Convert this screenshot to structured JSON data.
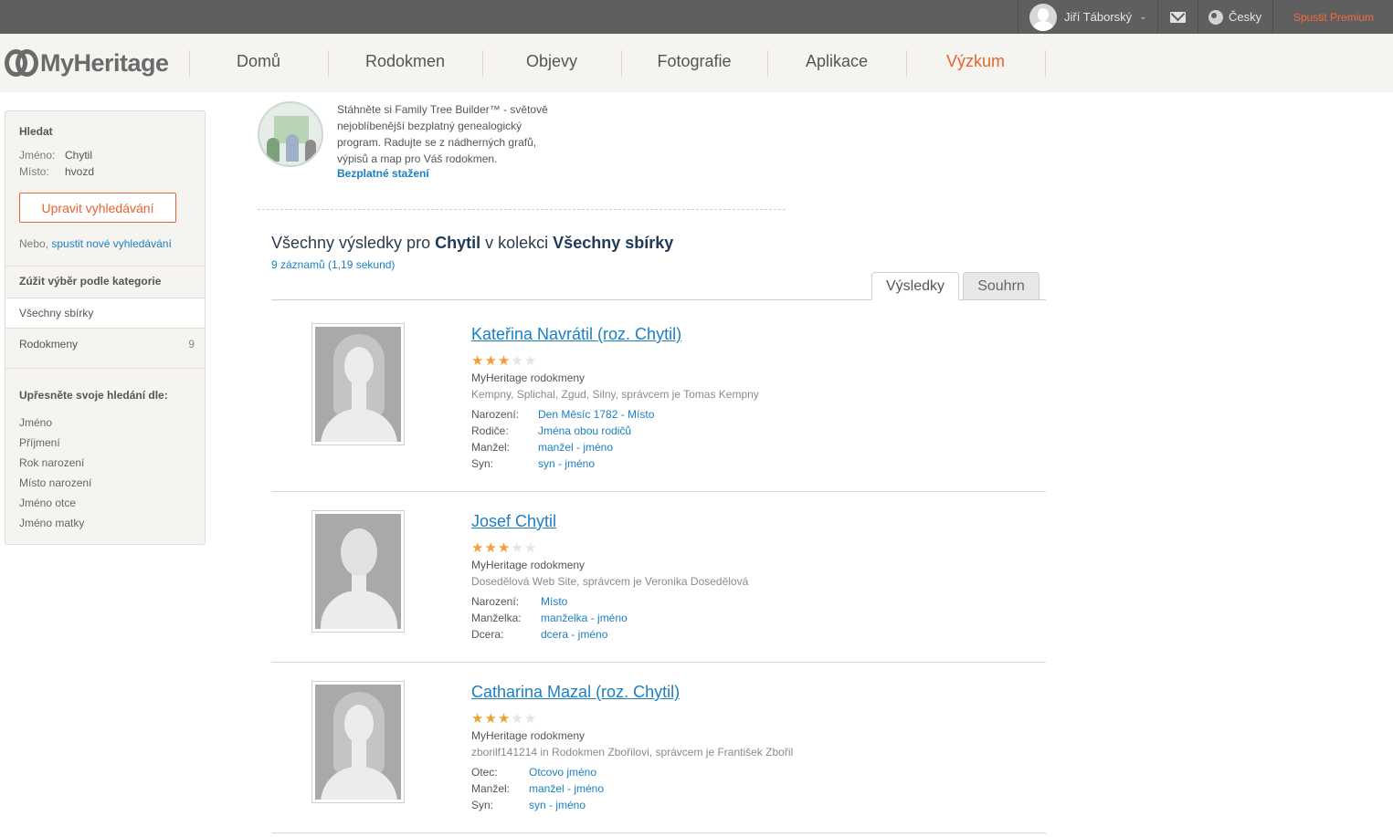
{
  "topbar": {
    "user_name": "Jiří Táborský",
    "language": "Česky",
    "premium_label": "Spustit Premium"
  },
  "logo": {
    "text": "MyHeritage"
  },
  "nav": {
    "items": [
      "Domů",
      "Rodokmen",
      "Objevy",
      "Fotografie",
      "Aplikace",
      "Výzkum"
    ],
    "active": "Výzkum"
  },
  "sidebar": {
    "search_title": "Hledat",
    "name_label": "Jméno:",
    "name_value": "Chytil",
    "place_label": "Místo:",
    "place_value": "hvozd",
    "edit_button": "Upravit vyhledávání",
    "or_text": "Nebo,",
    "new_search_link": "spustit nové vyhledávání",
    "category_title": "Zúžit výběr podle kategorie",
    "category_all": "Všechny sbírky",
    "category_row_label": "Rodokmeny",
    "category_row_count": "9",
    "refine_title": "Upřesněte svoje hledání dle:",
    "refine_items": [
      "Jméno",
      "Příjmení",
      "Rok narození",
      "Místo narození",
      "Jméno otce",
      "Jméno matky"
    ]
  },
  "promo": {
    "text": "Stáhněte si Family Tree Builder™ - světově nejoblíbenější bezplatný genealogický program. Radujte se z nádherných grafů, výpisů a map pro Váš rodokmen.",
    "link": "Bezplatné stažení"
  },
  "results": {
    "title_prefix": "Všechny výsledky pro",
    "query": "Chytil",
    "title_mid": "v kolekci",
    "collection": "Všechny sbírky",
    "count_text": "9 záznamů (1,19 sekund)",
    "tabs": [
      "Výsledky",
      "Souhrn"
    ],
    "items": [
      {
        "name": "Kateřina Navrátil (roz. Chytil)",
        "rating": 3,
        "source": "MyHeritage rodokmeny",
        "subtitle": "Kempny, Splichal, Zgud, Silny, správcem je Tomas Kempny",
        "fields": [
          {
            "label": "Narození:",
            "value": "Den Měsíc 1782 - Místo"
          },
          {
            "label": "Rodiče:",
            "value": "Jména obou rodičů"
          },
          {
            "label": "Manžel:",
            "value": "manžel - jméno"
          },
          {
            "label": "Syn:",
            "value": "syn - jméno"
          }
        ]
      },
      {
        "name": "Josef Chytil",
        "rating": 3,
        "source": "MyHeritage rodokmeny",
        "subtitle": "Dosedělová Web Site, správcem je Veronika Dosedělová",
        "fields": [
          {
            "label": "Narození:",
            "value": "Místo"
          },
          {
            "label": "Manželka:",
            "value": "manželka - jméno"
          },
          {
            "label": "Dcera:",
            "value": "dcera - jméno"
          }
        ]
      },
      {
        "name": "Catharina Mazal (roz. Chytil)",
        "rating": 3,
        "source": "MyHeritage rodokmeny",
        "subtitle": "zborilf141214 in Rodokmen Zbořilovi, správcem je František Zbořil",
        "fields": [
          {
            "label": "Otec:",
            "value": "Otcovo jméno"
          },
          {
            "label": "Manžel:",
            "value": "manžel - jméno"
          },
          {
            "label": "Syn:",
            "value": "syn - jméno"
          }
        ]
      }
    ]
  },
  "colors": {
    "accent": "#e4632e",
    "link": "#1b7fc2",
    "star": "#f0a035",
    "topbar": "#5f5f5f"
  }
}
